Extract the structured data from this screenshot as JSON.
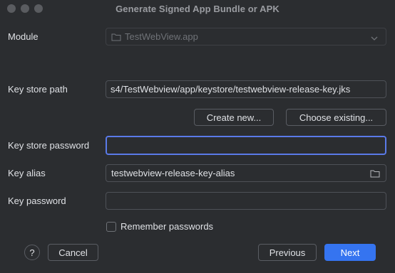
{
  "window": {
    "title": "Generate Signed App Bundle or APK"
  },
  "module": {
    "label": "Module",
    "value": "TestWebView.app"
  },
  "key_store_path": {
    "label": "Key store path",
    "value": "s4/TestWebview/app/keystore/testwebview-release-key.jks"
  },
  "buttons": {
    "create_new": "Create new...",
    "choose_existing": "Choose existing...",
    "cancel": "Cancel",
    "previous": "Previous",
    "next": "Next",
    "help": "?"
  },
  "key_store_password": {
    "label": "Key store password",
    "value": ""
  },
  "key_alias": {
    "label": "Key alias",
    "value": "testwebview-release-key-alias"
  },
  "key_password": {
    "label": "Key password",
    "value": ""
  },
  "remember_passwords": {
    "label": "Remember passwords",
    "checked": false
  },
  "colors": {
    "background": "#2b2d30",
    "accent": "#3574f0",
    "focus": "#5a7ae8"
  }
}
